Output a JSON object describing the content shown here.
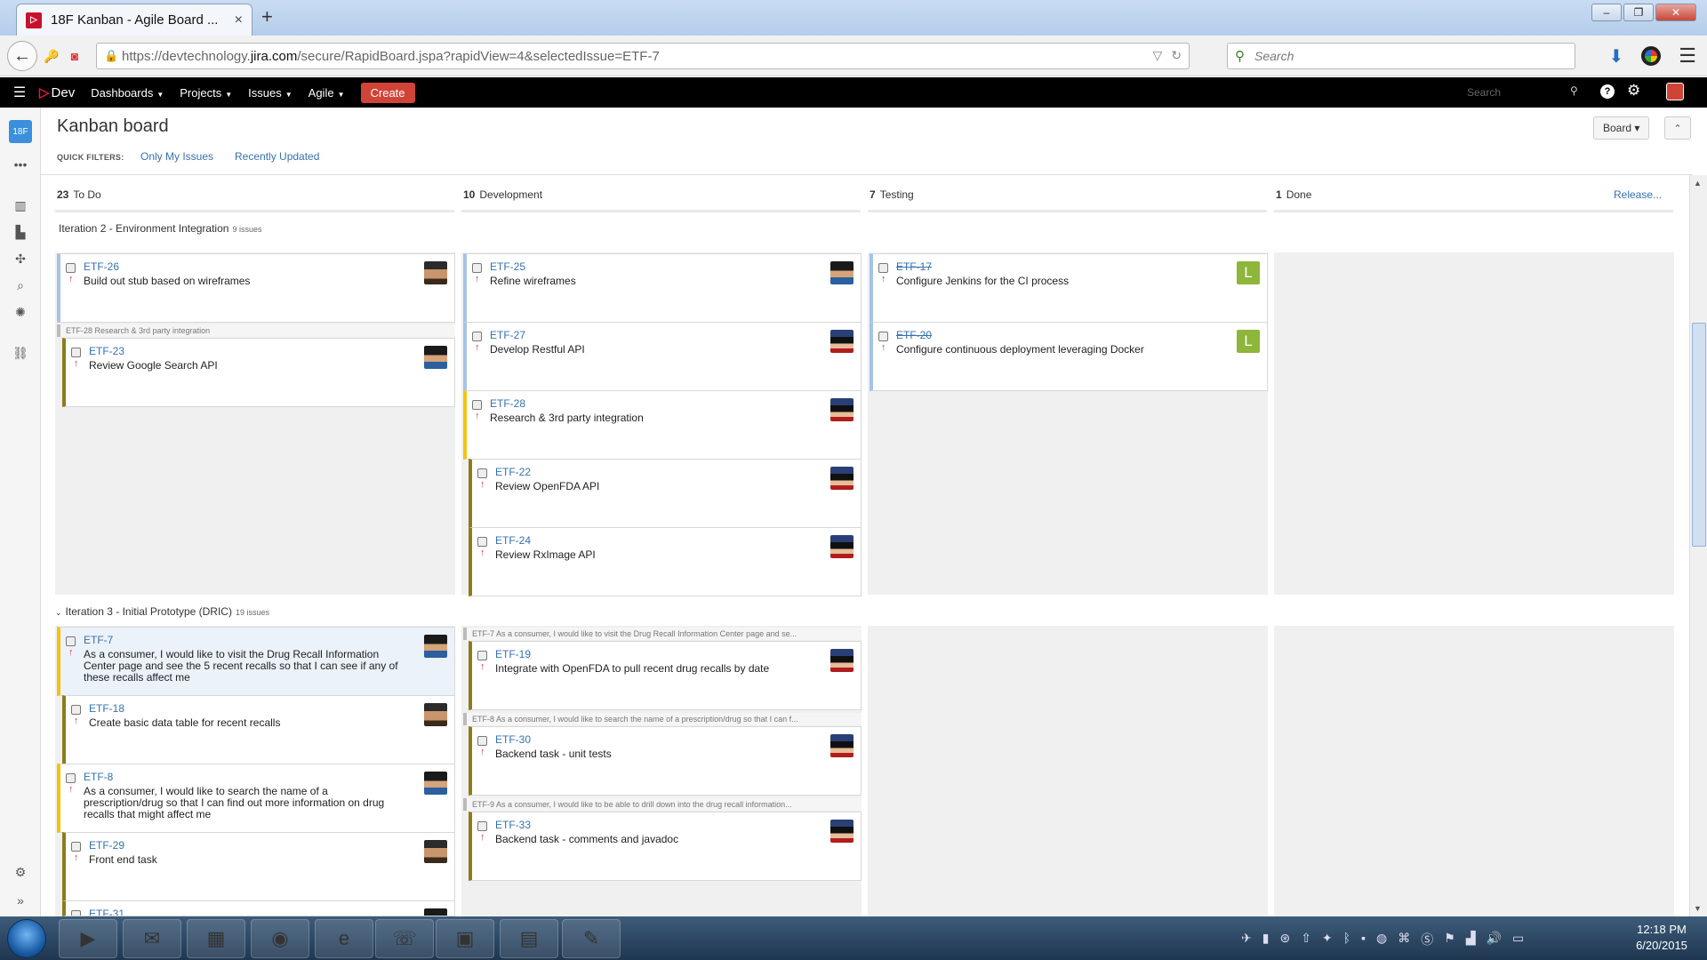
{
  "browser": {
    "tab_title": "18F Kanban - Agile Board ...",
    "tab_close": "×",
    "new_tab": "+",
    "url_prefix": "https://devtechnology.",
    "url_host": "jira.com",
    "url_path": "/secure/RapidBoard.jspa?rapidView=4&selectedIssue=ETF-7",
    "search_placeholder": "Search",
    "win_min": "–",
    "win_max": "❐",
    "win_close": "✕"
  },
  "jira": {
    "logo_mark": "▷",
    "logo_text": "Dev",
    "nav": [
      "Dashboards",
      "Projects",
      "Issues",
      "Agile"
    ],
    "create_label": "Create",
    "search_placeholder": "Search",
    "help": "?"
  },
  "sidebar": {
    "project_avatar": "18F"
  },
  "board": {
    "title": "Kanban board",
    "board_button": "Board ▾",
    "collapse_button": "⌃",
    "quick_filters_label": "QUICK FILTERS:",
    "quick_filters": [
      "Only My Issues",
      "Recently Updated"
    ],
    "release_link": "Release...",
    "columns": [
      {
        "count": "23",
        "name": "To Do"
      },
      {
        "count": "10",
        "name": "Development"
      },
      {
        "count": "7",
        "name": "Testing"
      },
      {
        "count": "1",
        "name": "Done"
      }
    ]
  },
  "swimlanes": [
    {
      "title": "Iteration 2 - Environment Integration",
      "count": "9 issues"
    },
    {
      "title": "Iteration 3 - Initial Prototype (DRIC)",
      "count": "19 issues"
    }
  ],
  "parents": {
    "p_etf28": "ETF-28  Research & 3rd party integration",
    "p_etf7": "ETF-7  As a consumer, I would like to visit the Drug Recall Information Center page and se...",
    "p_etf8": "ETF-8  As a consumer, I would like to search the name of a prescription/drug so that I can f...",
    "p_etf9": "ETF-9  As a consumer, I would like to be able to drill down into the drug recall information..."
  },
  "cards": {
    "etf26": {
      "key": "ETF-26",
      "summary": "Build out stub based on wireframes"
    },
    "etf23": {
      "key": "ETF-23",
      "summary": "Review Google Search API"
    },
    "etf25": {
      "key": "ETF-25",
      "summary": "Refine wireframes"
    },
    "etf27": {
      "key": "ETF-27",
      "summary": "Develop Restful API"
    },
    "etf28": {
      "key": "ETF-28",
      "summary": "Research & 3rd party integration"
    },
    "etf22": {
      "key": "ETF-22",
      "summary": "Review OpenFDA API"
    },
    "etf24": {
      "key": "ETF-24",
      "summary": "Review RxImage API"
    },
    "etf17": {
      "key": "ETF-17",
      "summary": "Configure Jenkins for the CI process",
      "avatar": "L"
    },
    "etf20": {
      "key": "ETF-20",
      "summary": "Configure continuous deployment leveraging Docker",
      "avatar": "L"
    },
    "etf7": {
      "key": "ETF-7",
      "summary": "As a consumer, I would like to visit the Drug Recall Information Center page and see the 5 recent recalls so that I can see if any of these recalls affect me"
    },
    "etf18": {
      "key": "ETF-18",
      "summary": "Create basic data table for recent recalls"
    },
    "etf8": {
      "key": "ETF-8",
      "summary": "As a consumer, I would like to search the name of a prescription/drug so that I can find out more information on drug recalls that might affect me"
    },
    "etf29": {
      "key": "ETF-29",
      "summary": "Front end task"
    },
    "etf31": {
      "key": "ETF-31",
      "summary": ""
    },
    "etf19": {
      "key": "ETF-19",
      "summary": "Integrate with OpenFDA to pull recent drug recalls by date"
    },
    "etf30": {
      "key": "ETF-30",
      "summary": "Backend task - unit tests"
    },
    "etf33": {
      "key": "ETF-33",
      "summary": "Backend task - comments and javadoc"
    }
  },
  "priority_glyph": "↑",
  "taskbar": {
    "time": "12:18 PM",
    "date": "6/20/2015"
  },
  "colors": {
    "accent": "#3572b0",
    "create": "#d04437",
    "epic_yellow": "#f1c40f",
    "subtask_olive": "#8b7d1c",
    "header": "#000000"
  }
}
